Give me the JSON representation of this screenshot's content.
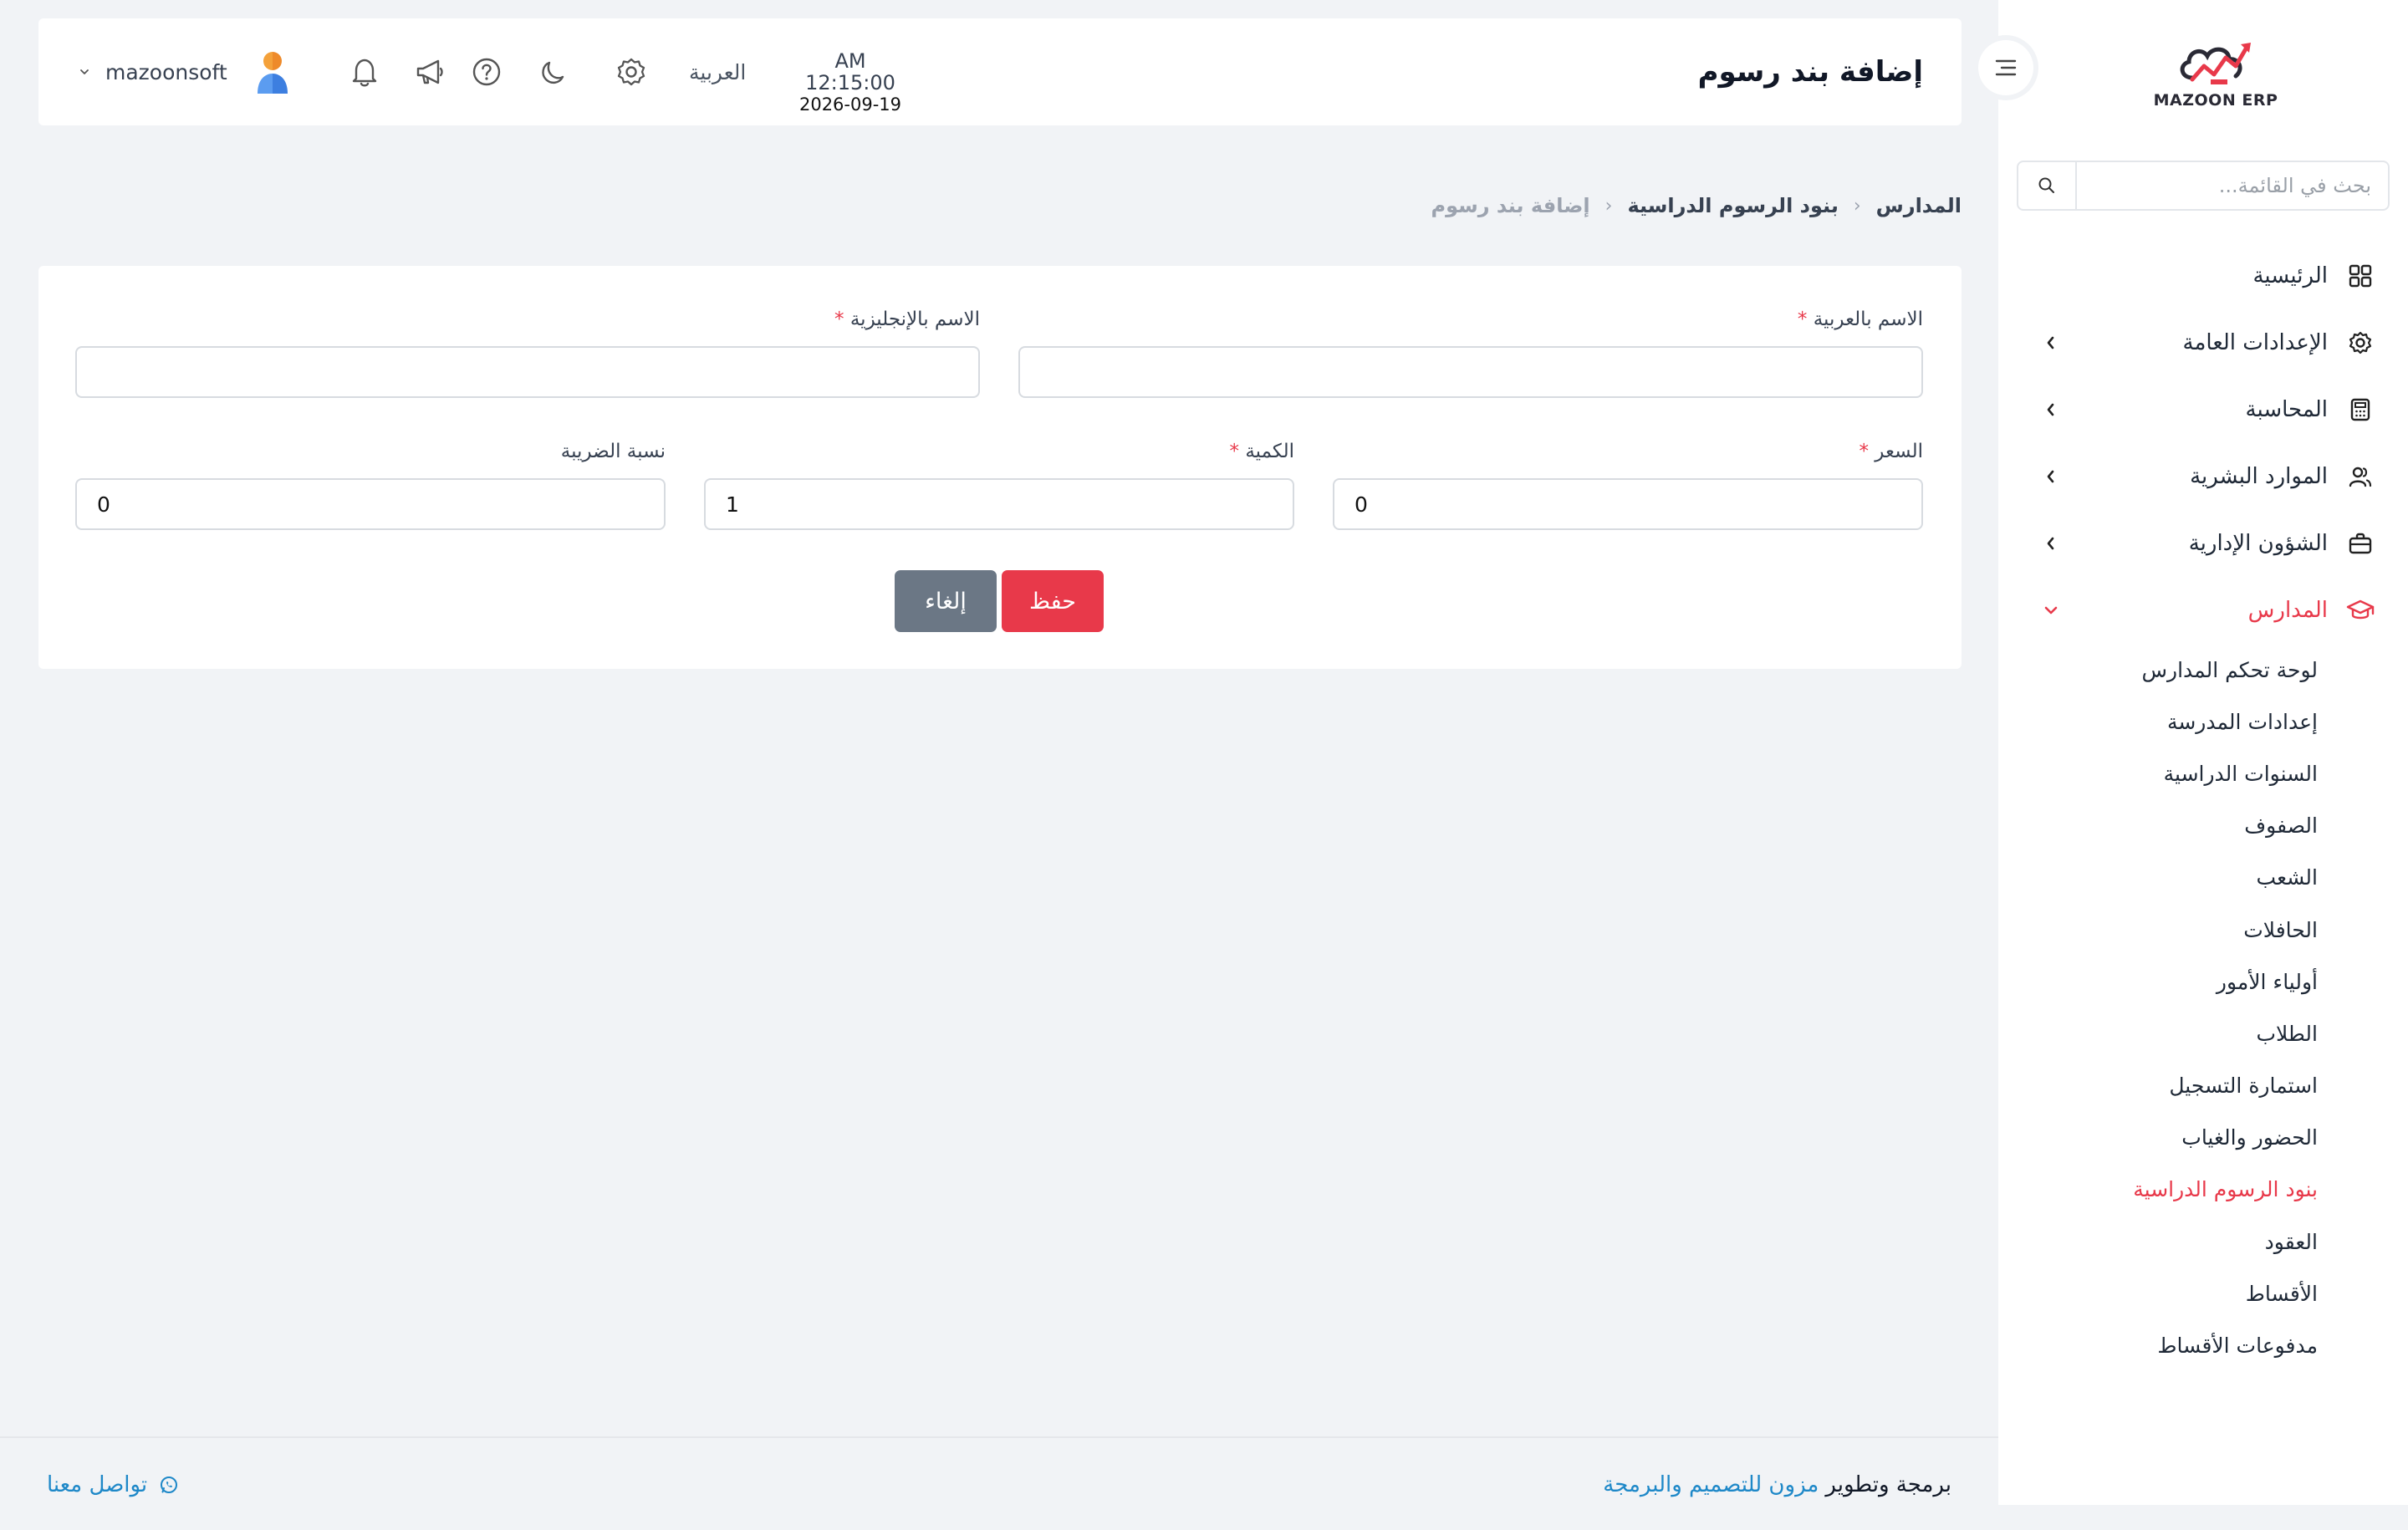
{
  "app": {
    "logo_text": "MAZOON ERP"
  },
  "header": {
    "title": "إضافة بند رسوم",
    "time": "AM 12:15:00",
    "date": "2026-09-19",
    "language": "العربية",
    "username": "mazoonsoft"
  },
  "sidebar": {
    "search_placeholder": "بحث في القائمة...",
    "items": [
      {
        "label": "الرئيسية",
        "icon": "grid-icon"
      },
      {
        "label": "الإعدادات العامة",
        "icon": "gear-icon"
      },
      {
        "label": "المحاسبة",
        "icon": "calculator-icon"
      },
      {
        "label": "الموارد البشرية",
        "icon": "users-icon"
      },
      {
        "label": "الشؤون الإدارية",
        "icon": "briefcase-icon"
      },
      {
        "label": "المدارس",
        "icon": "graduation-cap-icon"
      }
    ],
    "schools_sub": [
      "لوحة تحكم المدارس",
      "إعدادات المدرسة",
      "السنوات الدراسية",
      "الصفوف",
      "الشعب",
      "الحافلات",
      "أولياء الأمور",
      "الطلاب",
      "استمارة التسجيل",
      "الحضور والغياب",
      "بنود الرسوم الدراسية",
      "العقود",
      "الأقساط",
      "مدفوعات الأقساط"
    ]
  },
  "breadcrumb": {
    "level1": "المدارس",
    "level2": "بنود الرسوم الدراسية",
    "current": "إضافة بند رسوم"
  },
  "form": {
    "name_ar_label": "الاسم بالعربية",
    "name_en_label": "الاسم بالإنجليزية",
    "price_label": "السعر",
    "quantity_label": "الكمية",
    "tax_label": "نسبة الضريبة",
    "required_mark": "*",
    "name_ar_value": "",
    "name_en_value": "",
    "price_value": "0",
    "quantity_value": "1",
    "tax_value": "0",
    "save_label": "حفظ",
    "cancel_label": "إلغاء"
  },
  "footer": {
    "credit_prefix": "برمجة وتطوير",
    "credit_brand": "مزون للتصميم والبرمجة",
    "contact_label": "تواصل معنا"
  },
  "colors": {
    "accent": "#e8394a",
    "link": "#1e88c8",
    "cancel_button": "#6b7785",
    "background": "#f1f3f6"
  }
}
